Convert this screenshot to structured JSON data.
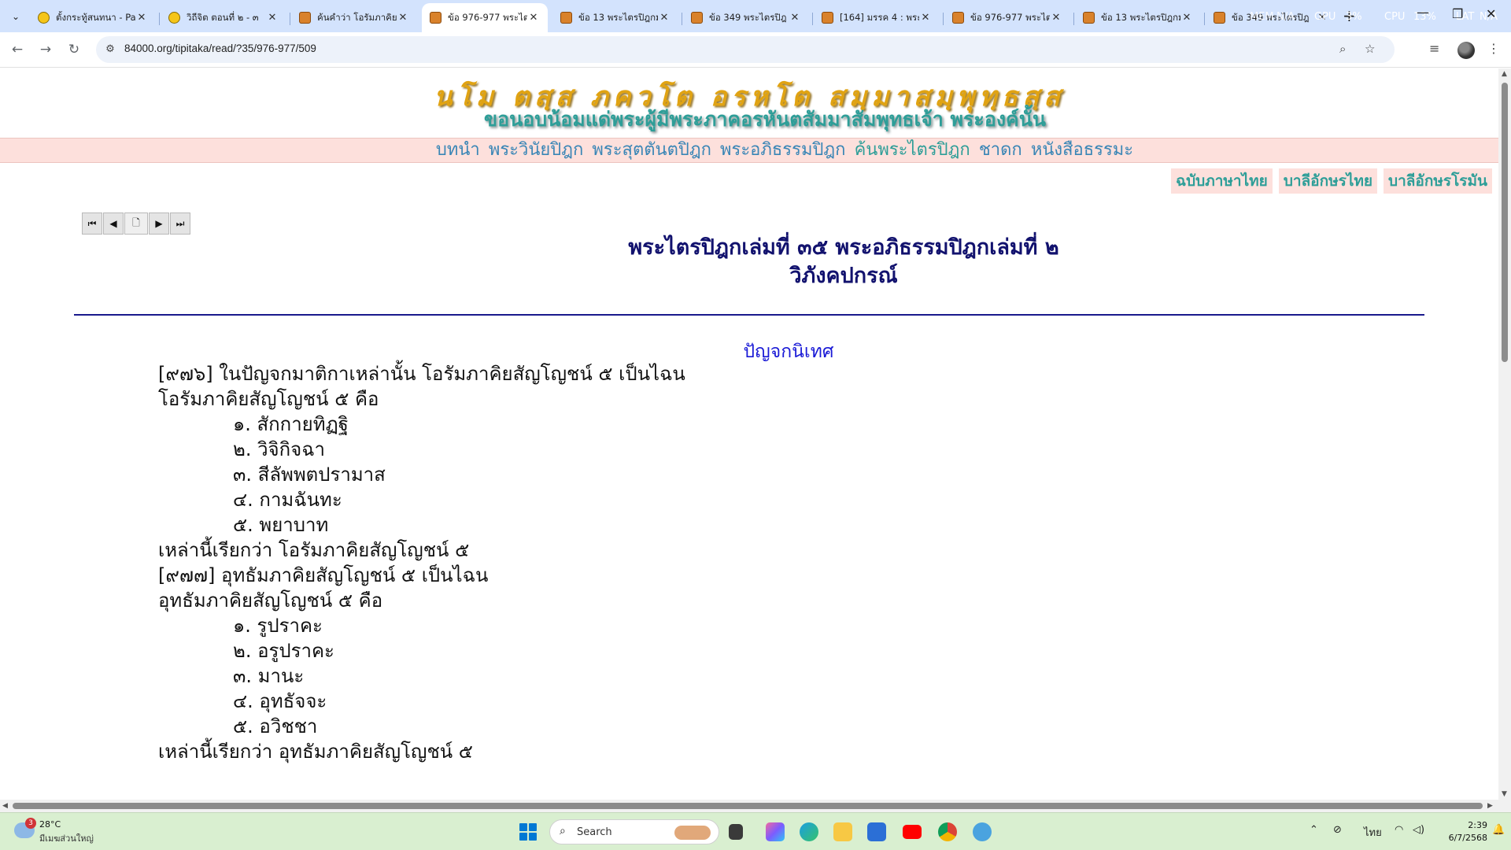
{
  "browser": {
    "tabs": [
      {
        "title": "ตั้งกระทู้สนทนา - Pa",
        "favicon": "emoji-icon",
        "active": false
      },
      {
        "title": "วิถีจิต ตอนที่ ๒ - ๓",
        "favicon": "emoji-icon",
        "active": false
      },
      {
        "title": "ค้นคำว่า โอรัมภาคิยสั",
        "favicon": "dhamma-icon",
        "active": false
      },
      {
        "title": "ข้อ 976-977 พระไต",
        "favicon": "dhamma-icon",
        "active": true
      },
      {
        "title": "ข้อ 13 พระไตรปิฎกม",
        "favicon": "dhamma-icon",
        "active": false
      },
      {
        "title": "ข้อ 349 พระไตรปิฎ",
        "favicon": "dhamma-icon",
        "active": false
      },
      {
        "title": "[164] มรรค 4 : พระม",
        "favicon": "dhamma-icon",
        "active": false
      },
      {
        "title": "ข้อ 976-977 พระไต",
        "favicon": "dhamma-icon",
        "active": false
      },
      {
        "title": "ข้อ 13 พระไตรปิฎกม",
        "favicon": "dhamma-icon",
        "active": false
      },
      {
        "title": "ข้อ 349 พระไตรปิฎ",
        "favicon": "dhamma-icon",
        "active": false
      }
    ],
    "perf": {
      "mem_label": "MEM",
      "mem_value": "N/A",
      "gpu_label": "GPU",
      "gpu_value": "3%",
      "cpu_label": "CPU",
      "cpu_value": "13%",
      "lat_label": "LAT",
      "lat_value": "N/A"
    },
    "url": "84000.org/tipitaka/read/?35/976-977/509"
  },
  "page": {
    "pali_header": "นโม ตสฺส ภควโต อรหโต สมฺมาสมฺพุทฺธสฺส",
    "thai_header": "ขอนอบน้อมแด่พระผู้มีพระภาคอรหันตสัมมาสัมพุทธเจ้า  พระองค์นั้น",
    "menu": [
      "บทนำ",
      "พระวินัยปิฎก",
      "พระสุตตันตปิฎก",
      "พระอภิธรรมปิฎก",
      "ค้นพระไตรปิฎก",
      "ชาดก",
      "หนังสือธรรมะ"
    ],
    "lang_buttons": [
      "ฉบับภาษาไทย",
      "บาลีอักษรไทย",
      "บาลีอักษรโรมัน"
    ],
    "title_line1": "พระไตรปิฎกเล่มที่ ๓๕  พระอภิธรรมปิฎกเล่มที่ ๒",
    "title_line2": "วิภังคปกรณ์",
    "section": "ปัญจกนิเทศ",
    "lines": [
      {
        "text": "[๙๗๖] ในปัญจกมาติกาเหล่านั้น โอรัมภาคิยสัญโญชน์ ๕ เป็นไฉน",
        "indent": false
      },
      {
        "text": "โอรัมภาคิยสัญโญชน์ ๕ คือ",
        "indent": false
      },
      {
        "text": "๑. สักกายทิฏฐิ",
        "indent": true
      },
      {
        "text": "๒. วิจิกิจฉา",
        "indent": true
      },
      {
        "text": "๓. สีลัพพตปรามาส",
        "indent": true
      },
      {
        "text": "๔. กามฉันทะ",
        "indent": true
      },
      {
        "text": "๕. พยาบาท",
        "indent": true
      },
      {
        "text": "เหล่านี้เรียกว่า โอรัมภาคิยสัญโญชน์ ๕",
        "indent": false
      },
      {
        "text": "[๙๗๗] อุทธัมภาคิยสัญโญชน์ ๕ เป็นไฉน",
        "indent": false
      },
      {
        "text": "อุทธัมภาคิยสัญโญชน์ ๕ คือ",
        "indent": false
      },
      {
        "text": "๑. รูปราคะ",
        "indent": true
      },
      {
        "text": "๒. อรูปราคะ",
        "indent": true
      },
      {
        "text": "๓. มานะ",
        "indent": true
      },
      {
        "text": "๔. อุทธัจจะ",
        "indent": true
      },
      {
        "text": "๕. อวิชชา",
        "indent": true
      },
      {
        "text": "เหล่านี้เรียกว่า อุทธัมภาคิยสัญโญชน์ ๕",
        "indent": false
      }
    ]
  },
  "taskbar": {
    "weather_temp": "28°C",
    "weather_desc": "มีเมฆส่วนใหญ่",
    "weather_badge": "3",
    "search_placeholder": "Search",
    "lang": "ไทย",
    "time": "2:39",
    "date": "6/7/2568"
  },
  "colors": {
    "pali": "#e0a313",
    "thai_header": "#2e9e98",
    "menu_link": "#3a86b6",
    "title": "#12126e",
    "section": "#1a1ad6",
    "menu_bg": "#fde0dc"
  }
}
